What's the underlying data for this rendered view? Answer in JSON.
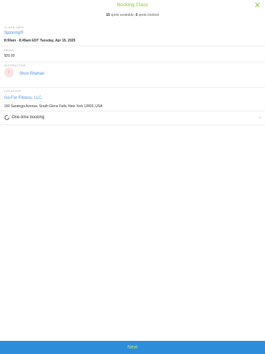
{
  "header": {
    "title": "Booking Class",
    "spots_available": "15",
    "spots_available_text": "spots available,",
    "spots_booked": "0",
    "spots_booked_text": "spots booked"
  },
  "class_info": {
    "label": "CLASS INFO",
    "name": "Spinning®",
    "datetime": "8:00am - 8:45am EDT Tuesday, Apr 15, 2025"
  },
  "price": {
    "label": "PRICE",
    "value": "$20.00"
  },
  "instructor": {
    "label": "INSTRUCTOR",
    "name": "Shon Ritahari"
  },
  "location": {
    "label": "LOCATION",
    "name": "Go-For Fitness, LLC",
    "address": "160 Saratoga Avenue, South Glens Falls, New York 12803, USA"
  },
  "booking": {
    "label": "One-time booking"
  },
  "footer": {
    "next_label": "Next"
  },
  "colors": {
    "accent": "#8cc63f",
    "link": "#4a90e2",
    "footer_bg": "#2d8ddb"
  }
}
